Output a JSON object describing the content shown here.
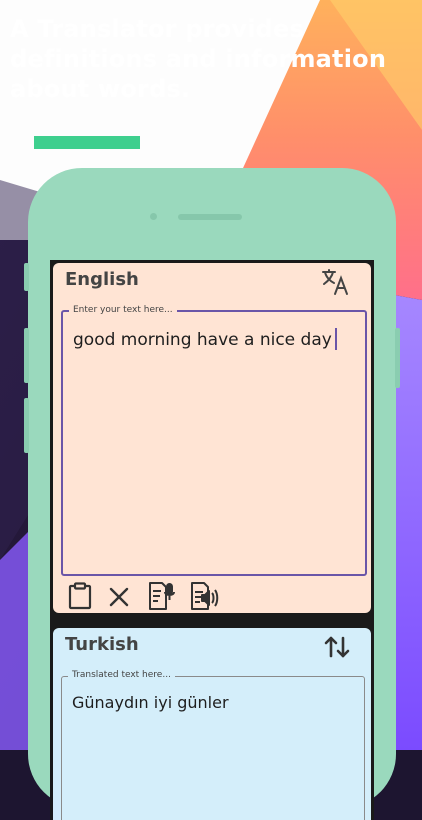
{
  "headline": {
    "line1": "A Translator provides",
    "line2": "definitions and information",
    "line3": "about words."
  },
  "colors": {
    "accent_bar": "#3ecf8e",
    "phone_body": "#9ad9bd",
    "source_panel": "#ffe4d4",
    "target_panel": "#d4eefa",
    "field_border": "#6a55a8"
  },
  "source": {
    "language": "English",
    "placeholder": "Enter your text here...",
    "text": "good morning have a nice day",
    "translate_icon": "translate-icon",
    "actions": [
      "clipboard-paste-icon",
      "clear-x-icon",
      "speech-to-text-icon",
      "text-to-speech-icon"
    ]
  },
  "target": {
    "language": "Turkish",
    "placeholder": "Translated text here...",
    "text": "Günaydın iyi günler",
    "swap_icon": "swap-arrows-icon"
  }
}
